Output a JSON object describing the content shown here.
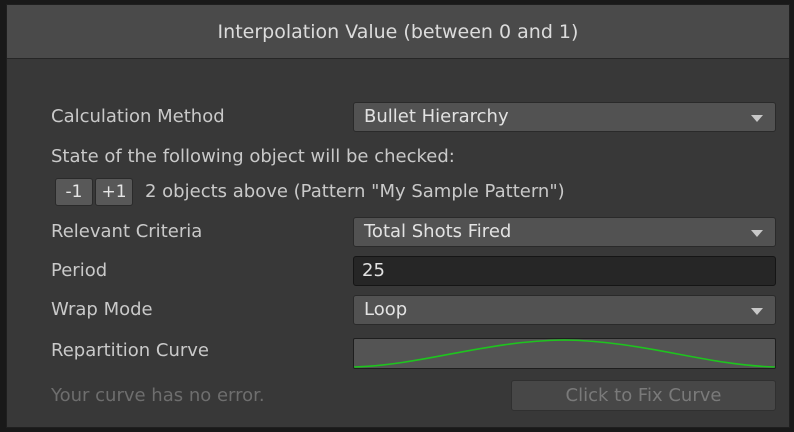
{
  "header": {
    "title": "Interpolation Value (between 0 and 1)"
  },
  "calculation_method": {
    "label": "Calculation Method",
    "value": "Bullet Hierarchy"
  },
  "state_info": {
    "text": "State of the following object will be checked:"
  },
  "hierarchy": {
    "minus_label": "-1",
    "plus_label": "+1",
    "description": "2 objects above (Pattern \"My Sample Pattern\")"
  },
  "relevant_criteria": {
    "label": "Relevant Criteria",
    "value": "Total Shots Fired"
  },
  "period": {
    "label": "Period",
    "value": "25"
  },
  "wrap_mode": {
    "label": "Wrap Mode",
    "value": "Loop"
  },
  "repartition_curve": {
    "label": "Repartition Curve",
    "curve_color": "#1ec41e"
  },
  "curve_status": {
    "message": "Your curve has no error.",
    "fix_button_label": "Click to Fix Curve"
  },
  "colors": {
    "panel": "#383838",
    "header": "#4a4a4a",
    "dropdown": "#525252",
    "text_field": "#262626",
    "label_text": "#c9c9c9",
    "muted_text": "#6e6e6e"
  }
}
